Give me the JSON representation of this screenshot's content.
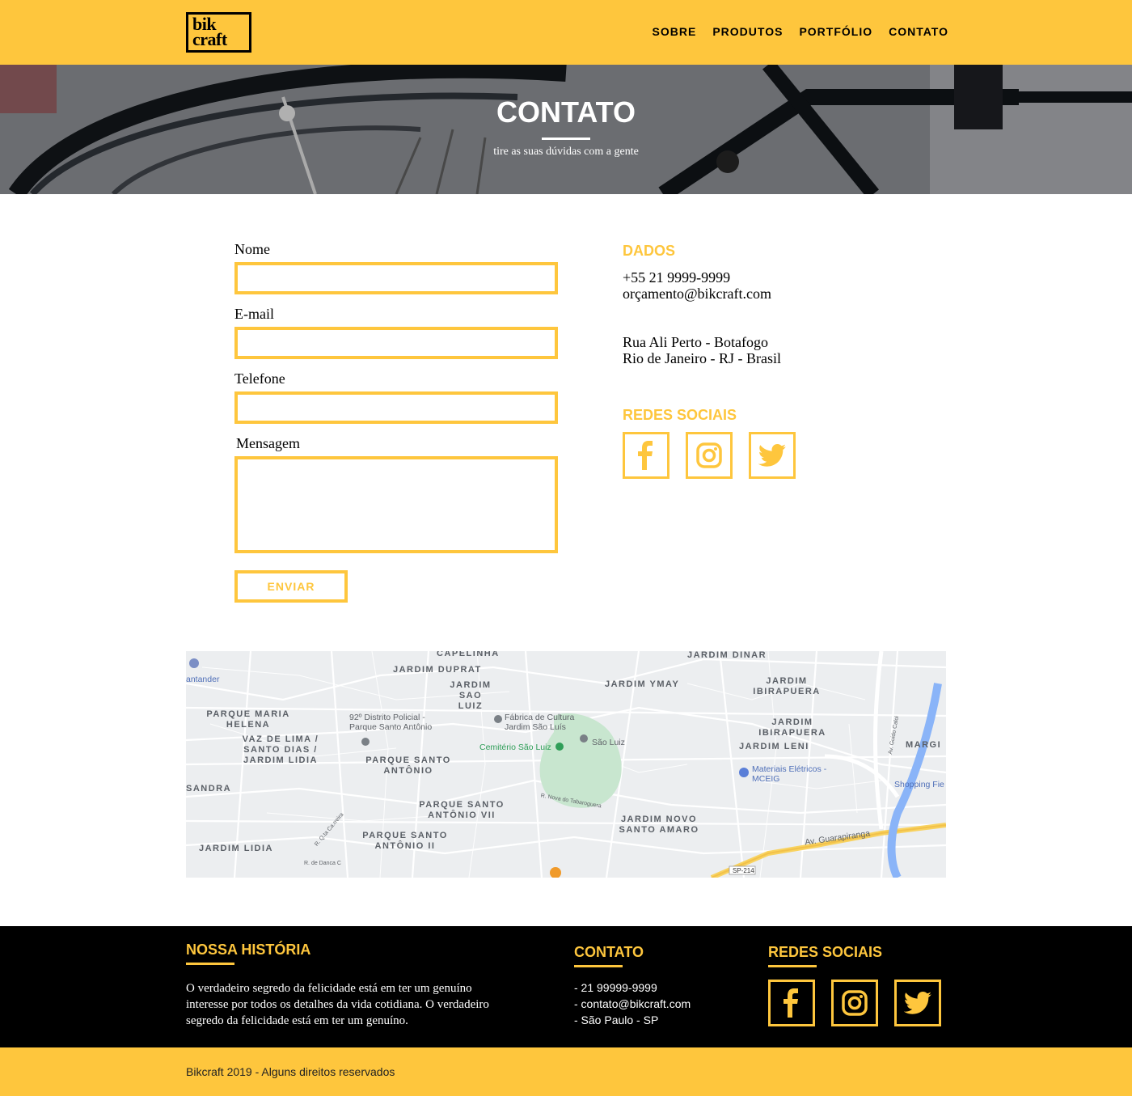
{
  "brand": {
    "logo_line1": "bik",
    "logo_line2": "craft"
  },
  "nav": {
    "items": [
      "SOBRE",
      "PRODUTOS",
      "PORTFÓLIO",
      "CONTATO"
    ]
  },
  "hero": {
    "title": "CONTATO",
    "subtitle": "tire as suas dúvidas com a gente"
  },
  "form": {
    "name_label": "Nome",
    "email_label": "E-mail",
    "phone_label": "Telefone",
    "message_label": "Mensagem",
    "name_value": "",
    "email_value": "",
    "phone_value": "",
    "message_value": "",
    "submit_label": "ENVIAR"
  },
  "info": {
    "dados_title": "DADOS",
    "phone": "+55 21 9999-9999",
    "email": "orçamento@bikcraft.com",
    "address_line1": "Rua Ali Perto - Botafogo",
    "address_line2": "Rio de Janeiro - RJ - Brasil",
    "social_title": "REDES SOCIAIS",
    "social_icons": [
      "facebook-icon",
      "instagram-icon",
      "twitter-icon"
    ]
  },
  "map": {
    "labels": [
      "CAPELINHA",
      "JARDIM DINAR",
      "JARDIM DUPRAT",
      "JARDIM SAO LUIZ",
      "JARDIM YMAY",
      "JARDIM IBIRAPUERA",
      "PARQUE MARIA HELENA",
      "VAZ DE LIMA / SANTO DIAS / JARDIM LIDIA",
      "PARQUE SANTO ANTÔNIO",
      "JARDIM IBIRAPUERA",
      "JARDIM LENI",
      "SANDRA",
      "PARQUE SANTO ANTÔNIO VII",
      "JARDIM NOVO SANTO AMARO",
      "PARQUE SANTO ANTÔNIO II",
      "JARDIM LIDIA",
      "MARGI"
    ],
    "pois": [
      "antander",
      "92º Distrito Policial - Parque Santo Antônio",
      "Fábrica de Cultura Jardim São Luís",
      "Cemitério São Luiz",
      "São Luiz",
      "Materiais Elétricos - MCEIG",
      "Shopping Fie"
    ],
    "streets": [
      "Av. Guarapiranga",
      "SP-214",
      "R. Nova do Tabaroguera",
      "Av. Guido Caloi",
      "R. Q.ta Ca.rreira",
      "R. de Danca C"
    ]
  },
  "footer": {
    "history_title": "NOSSA HISTÓRIA",
    "history_text": "O verdadeiro segredo da felicidade está em ter um genuíno interesse por todos os detalhes da vida cotidiana. O verdadeiro segredo da felicidade está em ter um genuíno.",
    "contact_title": "CONTATO",
    "contact_lines": [
      "- 21 99999-9999",
      "- contato@bikcraft.com",
      "- São Paulo - SP"
    ],
    "social_title": "REDES SOCIAIS",
    "copyright": "Bikcraft 2019 - Alguns direitos reservados"
  },
  "colors": {
    "accent": "#FEC63D",
    "dark": "#000000",
    "white": "#FFFFFF"
  }
}
